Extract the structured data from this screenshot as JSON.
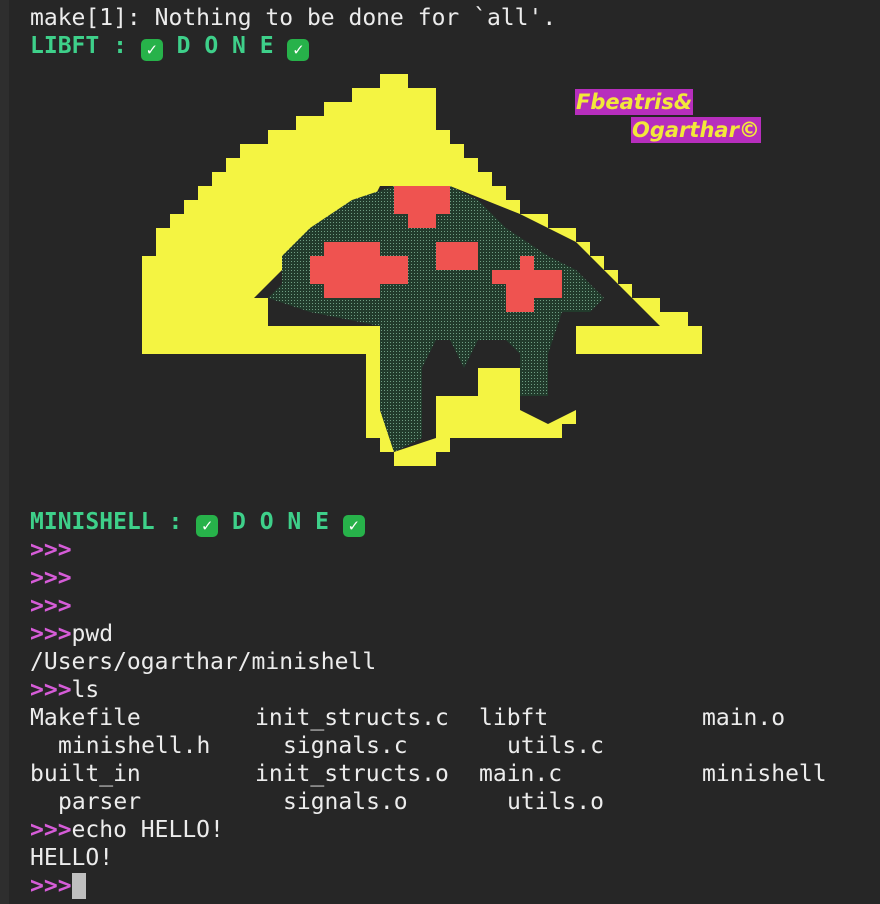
{
  "terminal": {
    "make_line": "make[1]: Nothing to be done for `all'.",
    "libft_status": {
      "label": "LIBFT : ",
      "done": " D O N E "
    },
    "credit": {
      "line1": "Fbeatris&",
      "line2": "Ogarthar©"
    },
    "minishell_status": {
      "label": "MINISHELL : ",
      "done": " D O N E "
    },
    "check_glyph": "✓",
    "prompt": ">>>",
    "commands": [
      {
        "cmd": ""
      },
      {
        "cmd": ""
      },
      {
        "cmd": ""
      },
      {
        "cmd": "pwd",
        "output": "/Users/ogarthar/minishell"
      },
      {
        "cmd": "ls"
      },
      {
        "cmd": "echo HELLO!",
        "output": "HELLO!"
      }
    ],
    "ls_output": [
      [
        "Makefile",
        "init_structs.c",
        "libft",
        "main.o"
      ],
      [
        "minishell.h",
        "signals.c",
        "utils.c"
      ],
      [
        "built_in",
        "init_structs.o",
        "main.c",
        "minishell"
      ],
      [
        "parser",
        "signals.o",
        "utils.o"
      ]
    ],
    "colors": {
      "background": "#262626",
      "text": "#ececec",
      "green": "#3ed08a",
      "prompt": "#d65cd8",
      "art_yellow": "#f4f442",
      "art_red": "#ef5350",
      "art_dark": "#223b2c",
      "credit_bg": "#b72ebd",
      "credit_text": "#f2e83a"
    }
  }
}
